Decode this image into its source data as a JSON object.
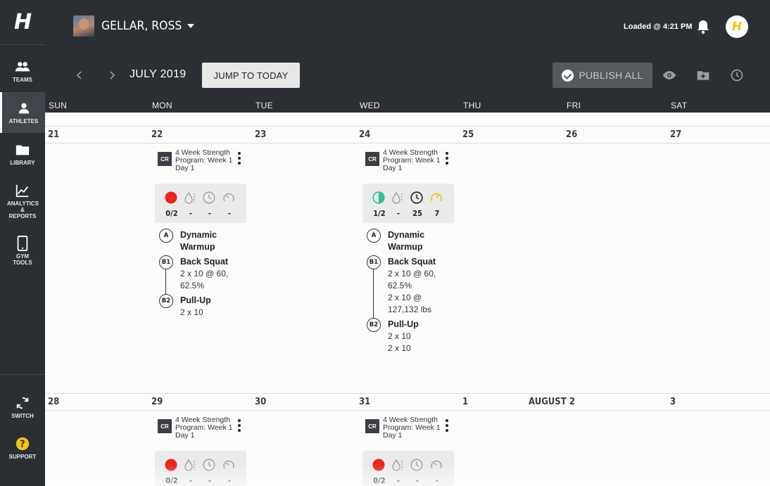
{
  "sidebar": {
    "logo": "H",
    "items": [
      {
        "label": "TEAMS",
        "icon": "teams-icon"
      },
      {
        "label": "ATHLETES",
        "icon": "athlete-icon"
      },
      {
        "label": "LIBRARY",
        "icon": "folder-icon"
      },
      {
        "label": "ANALYTICS & REPORTS",
        "icon": "analytics-icon"
      },
      {
        "label": "GYM TOOLS",
        "icon": "tablet-icon"
      },
      {
        "label": "SWITCH",
        "icon": "switch-icon"
      },
      {
        "label": "SUPPORT",
        "icon": "help-icon"
      }
    ],
    "active": "ATHLETES"
  },
  "header": {
    "athlete_name": "GELLAR, ROSS",
    "loaded_text": "Loaded @ 4:21 PM",
    "user_initial": "H",
    "month_label": "JULY 2019",
    "jump_label": "JUMP TO TODAY",
    "publish_label": "PUBLISH ALL",
    "colors": {
      "header_bg": "#2b2e33",
      "accent_yellow": "#f0c419",
      "red": "#e8261c",
      "green": "#2fbf8c"
    }
  },
  "days": [
    "SUN",
    "MON",
    "TUE",
    "WED",
    "THU",
    "FRI",
    "SAT"
  ],
  "weeks": [
    {
      "dates": [
        "21",
        "22",
        "23",
        "24",
        "25",
        "26",
        "27"
      ]
    },
    {
      "dates": [
        "28",
        "29",
        "30",
        "31",
        "1",
        "AUGUST 2",
        "3"
      ]
    }
  ],
  "cards": {
    "mon22": {
      "badge": "CR",
      "title": "4 Week Strength Program: Week 1 Day 1",
      "stats": [
        "0/2",
        "-",
        "-",
        "-"
      ],
      "exercises": [
        {
          "label": "A",
          "name": "Dynamic Warmup",
          "details": []
        },
        {
          "label": "B1",
          "name": "Back Squat",
          "details": [
            "2 x 10 @ 60, 62.5%"
          ]
        },
        {
          "label": "B2",
          "name": "Pull-Up",
          "details": [
            "2 x 10"
          ]
        }
      ]
    },
    "wed24": {
      "badge": "CR",
      "title": "4 Week Strength Program: Week 1 Day 1",
      "stats": [
        "1/2",
        "-",
        "25",
        "7"
      ],
      "exercises": [
        {
          "label": "A",
          "name": "Dynamic Warmup",
          "details": []
        },
        {
          "label": "B1",
          "name": "Back Squat",
          "details": [
            "2 x 10 @ 60, 62.5%",
            "2 x 10 @ 127,132 lbs"
          ]
        },
        {
          "label": "B2",
          "name": "Pull-Up",
          "details": [
            "2 x 10",
            "2 x 10"
          ]
        }
      ]
    },
    "mon29": {
      "badge": "CR",
      "title": "4 Week Strength Program: Week 1 Day 1",
      "stats": [
        "0/2",
        "-",
        "-",
        "-"
      ]
    },
    "wed31": {
      "badge": "CR",
      "title": "4 Week Strength Program: Week 1 Day 1",
      "stats": [
        "0/2",
        "-",
        "-",
        "-"
      ]
    }
  }
}
